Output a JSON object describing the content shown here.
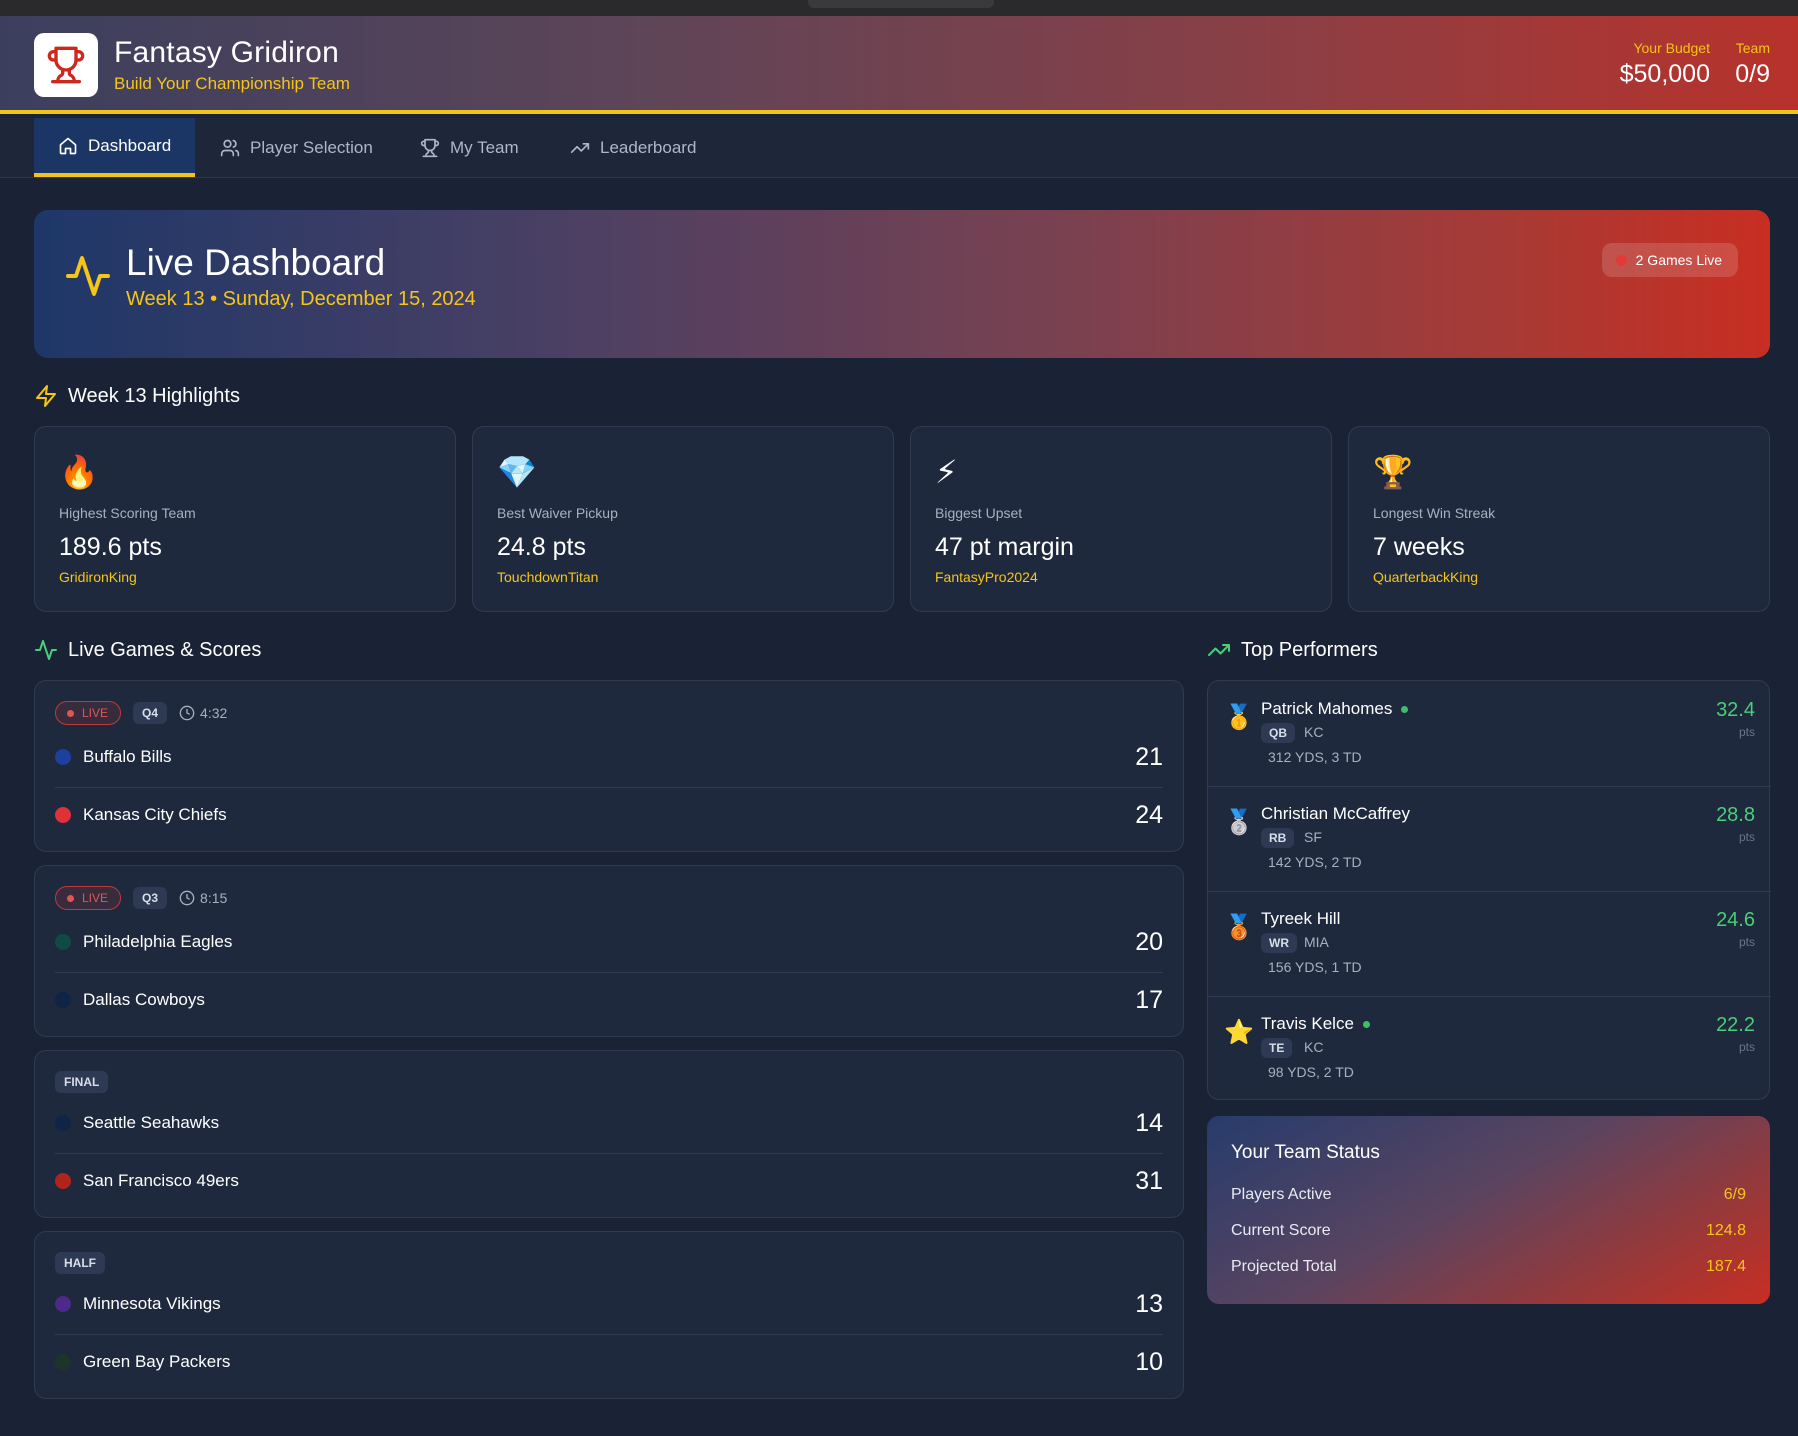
{
  "header": {
    "title": "Fantasy Gridiron",
    "subtitle": "Build Your Championship Team",
    "budget_label": "Your Budget",
    "budget_value": "$50,000",
    "team_label": "Team",
    "team_value": "0/9"
  },
  "nav": {
    "items": [
      {
        "label": "Dashboard",
        "icon": "home-icon",
        "active": true
      },
      {
        "label": "Player Selection",
        "icon": "users-icon",
        "active": false
      },
      {
        "label": "My Team",
        "icon": "trophy-icon",
        "active": false
      },
      {
        "label": "Leaderboard",
        "icon": "trending-up-icon",
        "active": false
      }
    ]
  },
  "hero": {
    "title": "Live Dashboard",
    "subtitle": "Week 13 • Sunday, December 15, 2024",
    "live_pill": "2 Games Live"
  },
  "highlights": {
    "title": "Week 13 Highlights",
    "cards": [
      {
        "emoji": "🔥",
        "icon": "fire-icon",
        "label": "Highest Scoring Team",
        "value": "189.6 pts",
        "team": "GridironKing"
      },
      {
        "emoji": "💎",
        "icon": "diamond-icon",
        "label": "Best Waiver Pickup",
        "value": "24.8 pts",
        "team": "TouchdownTitan"
      },
      {
        "emoji": "⚡",
        "icon": "lightning-icon",
        "label": "Biggest Upset",
        "value": "47 pt margin",
        "team": "FantasyPro2024"
      },
      {
        "emoji": "🏆",
        "icon": "trophy-icon",
        "label": "Longest Win Streak",
        "value": "7 weeks",
        "team": "QuarterbackKing"
      }
    ]
  },
  "games": {
    "title": "Live Games & Scores",
    "items": [
      {
        "status": "LIVE",
        "quarter": "Q4",
        "clock": "4:32",
        "teams": [
          {
            "name": "Buffalo Bills",
            "score": "21",
            "color": "#1d3f9e"
          },
          {
            "name": "Kansas City Chiefs",
            "score": "24",
            "color": "#e0303a"
          }
        ]
      },
      {
        "status": "LIVE",
        "quarter": "Q3",
        "clock": "8:15",
        "teams": [
          {
            "name": "Philadelphia Eagles",
            "score": "20",
            "color": "#0f4a44"
          },
          {
            "name": "Dallas Cowboys",
            "score": "17",
            "color": "#0e2546"
          }
        ]
      },
      {
        "status": "FINAL",
        "teams": [
          {
            "name": "Seattle Seahawks",
            "score": "14",
            "color": "#0e2546"
          },
          {
            "name": "San Francisco 49ers",
            "score": "31",
            "color": "#b0241d"
          }
        ]
      },
      {
        "status": "HALF",
        "teams": [
          {
            "name": "Minnesota Vikings",
            "score": "13",
            "color": "#4b2a8a"
          },
          {
            "name": "Green Bay Packers",
            "score": "10",
            "color": "#1d3528"
          }
        ]
      }
    ]
  },
  "performers": {
    "title": "Top Performers",
    "pts_label": "pts",
    "items": [
      {
        "medal": "🥇",
        "icon": "gold-medal-icon",
        "name": "Patrick Mahomes",
        "online": true,
        "pos": "QB",
        "team": "KC",
        "stat": "312 YDS, 3 TD",
        "pts": "32.4"
      },
      {
        "medal": "🥈",
        "icon": "silver-medal-icon",
        "name": "Christian McCaffrey",
        "online": false,
        "pos": "RB",
        "team": "SF",
        "stat": "142 YDS, 2 TD",
        "pts": "28.8"
      },
      {
        "medal": "🥉",
        "icon": "bronze-medal-icon",
        "name": "Tyreek Hill",
        "online": false,
        "pos": "WR",
        "team": "MIA",
        "stat": "156 YDS, 1 TD",
        "pts": "24.6"
      },
      {
        "medal": "⭐",
        "icon": "star-icon",
        "name": "Travis Kelce",
        "online": true,
        "pos": "TE",
        "team": "KC",
        "stat": "98 YDS, 2 TD",
        "pts": "22.2"
      }
    ]
  },
  "team_status": {
    "title": "Your Team Status",
    "rows": [
      {
        "label": "Players Active",
        "value": "6/9"
      },
      {
        "label": "Current Score",
        "value": "124.8"
      },
      {
        "label": "Projected Total",
        "value": "187.4"
      }
    ]
  },
  "colors": {
    "accent_yellow": "#f5c518",
    "live_red": "#e25555",
    "points_green": "#4ccd79",
    "card_bg": "#1f293d"
  }
}
